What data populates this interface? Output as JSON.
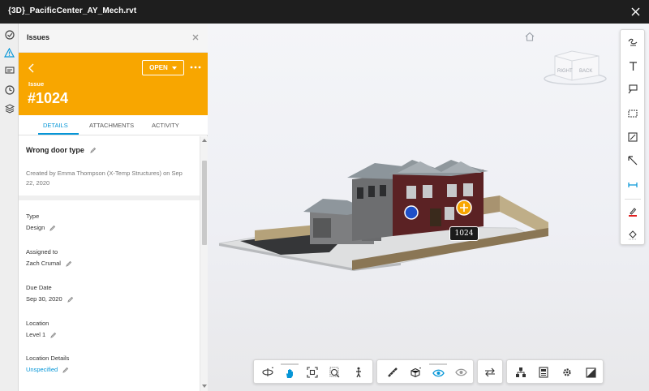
{
  "window": {
    "title": "{3D}_PacificCenter_AY_Mech.rvt"
  },
  "rail": {
    "icons": [
      "checklist-icon",
      "issues-warning-icon",
      "comment-icon",
      "history-icon",
      "layers-icon"
    ]
  },
  "panel": {
    "header_title": "Issues",
    "status_label": "OPEN",
    "issue_label": "Issue",
    "issue_number": "#1024",
    "tabs": [
      "DETAILS",
      "ATTACHMENTS",
      "ACTIVITY"
    ],
    "active_tab": "DETAILS",
    "title": "Wrong door type",
    "created_by": "Created by Emma Thompson (X-Temp Structures) on Sep 22, 2020",
    "fields": [
      {
        "label": "Type",
        "value": "Design"
      },
      {
        "label": "Assigned to",
        "value": "Zach Crumal"
      },
      {
        "label": "Due Date",
        "value": "Sep 30, 2020"
      },
      {
        "label": "Location",
        "value": "Level 1"
      },
      {
        "label": "Location Details",
        "value": "Unspecified"
      }
    ]
  },
  "viewer": {
    "viewcube": {
      "right": "RIGHT",
      "back": "BACK"
    },
    "issue_tag": "1024"
  },
  "colors": {
    "banner": "#f8a600",
    "accent": "#0696d7",
    "titlebar": "#1e1e1e"
  }
}
